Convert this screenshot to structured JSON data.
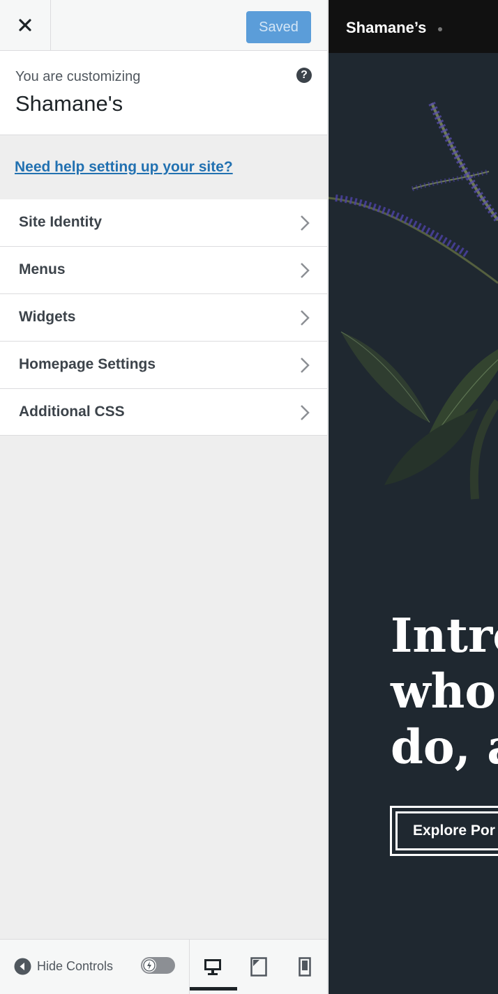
{
  "sidebar": {
    "header": {
      "saved_label": "Saved"
    },
    "info": {
      "label": "You are customizing",
      "site_title": "Shamane's",
      "help_icon": "?"
    },
    "help_link": "Need help setting up your site?",
    "menu_items": [
      {
        "label": "Site Identity"
      },
      {
        "label": "Menus"
      },
      {
        "label": "Widgets"
      },
      {
        "label": "Homepage Settings"
      },
      {
        "label": "Additional CSS"
      }
    ],
    "footer": {
      "hide_controls_label": "Hide Controls",
      "devices": [
        "desktop",
        "tablet",
        "mobile"
      ],
      "active_device": "desktop"
    }
  },
  "preview": {
    "site_name": "Shamane’s",
    "hero_lines": [
      "Intro",
      "who y",
      "do, a"
    ],
    "button_label": "Explore Por"
  },
  "colors": {
    "accent": "#2271b1",
    "saved_button": "#5b9dd9",
    "preview_bg": "#1f2830"
  }
}
